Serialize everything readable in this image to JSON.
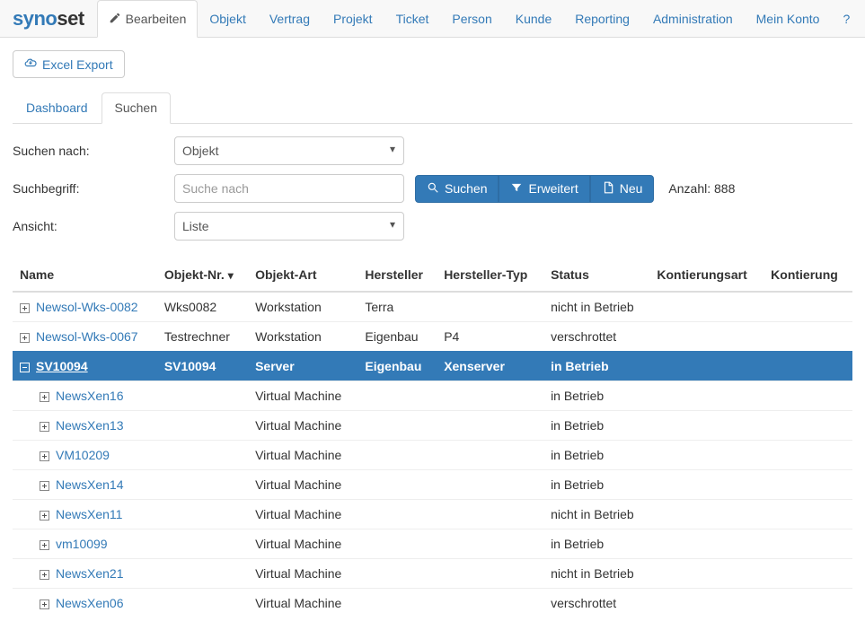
{
  "logo": {
    "part1": "syno",
    "part2": "set"
  },
  "nav": {
    "items": [
      {
        "label": "Bearbeiten",
        "icon": "edit",
        "active": true
      },
      {
        "label": "Objekt"
      },
      {
        "label": "Vertrag"
      },
      {
        "label": "Projekt"
      },
      {
        "label": "Ticket"
      },
      {
        "label": "Person"
      },
      {
        "label": "Kunde"
      },
      {
        "label": "Reporting"
      },
      {
        "label": "Administration"
      },
      {
        "label": "Mein Konto"
      },
      {
        "label": "?"
      }
    ]
  },
  "toolbar": {
    "excel_label": "Excel Export"
  },
  "subtabs": {
    "items": [
      {
        "label": "Dashboard",
        "active": false
      },
      {
        "label": "Suchen",
        "active": true
      }
    ]
  },
  "form": {
    "search_by_label": "Suchen nach:",
    "search_by_value": "Objekt",
    "term_label": "Suchbegriff:",
    "term_placeholder": "Suche nach",
    "term_value": "",
    "view_label": "Ansicht:",
    "view_value": "Liste",
    "buttons": {
      "search": "Suchen",
      "extended": "Erweitert",
      "new": "Neu"
    },
    "count_label": "Anzahl: 888"
  },
  "table": {
    "headers": {
      "name": "Name",
      "objnr": "Objekt-Nr.",
      "objart": "Objekt-Art",
      "hersteller": "Hersteller",
      "herstellertyp": "Hersteller-Typ",
      "status": "Status",
      "kontierungsart": "Kontierungsart",
      "kontierung": "Kontierung"
    },
    "sort": {
      "column": "objnr",
      "dir": "desc"
    },
    "rows": [
      {
        "level": 0,
        "expand": "plus",
        "selected": false,
        "name": "Newsol-Wks-0082",
        "objnr": "Wks0082",
        "art": "Workstation",
        "hersteller": "Terra",
        "htyp": "",
        "status": "nicht in Betrieb"
      },
      {
        "level": 0,
        "expand": "plus",
        "selected": false,
        "name": "Newsol-Wks-0067",
        "objnr": "Testrechner",
        "art": "Workstation",
        "hersteller": "Eigenbau",
        "htyp": "P4",
        "status": "verschrottet"
      },
      {
        "level": 0,
        "expand": "minus",
        "selected": true,
        "name": "SV10094",
        "objnr": "SV10094",
        "art": "Server",
        "hersteller": "Eigenbau",
        "htyp": "Xenserver",
        "status": "in Betrieb"
      },
      {
        "level": 1,
        "expand": "plus",
        "selected": false,
        "name": "NewsXen16",
        "objnr": "",
        "art": "Virtual Machine",
        "hersteller": "",
        "htyp": "",
        "status": "in Betrieb"
      },
      {
        "level": 1,
        "expand": "plus",
        "selected": false,
        "name": "NewsXen13",
        "objnr": "",
        "art": "Virtual Machine",
        "hersteller": "",
        "htyp": "",
        "status": "in Betrieb"
      },
      {
        "level": 1,
        "expand": "plus",
        "selected": false,
        "name": "VM10209",
        "objnr": "",
        "art": "Virtual Machine",
        "hersteller": "",
        "htyp": "",
        "status": "in Betrieb"
      },
      {
        "level": 1,
        "expand": "plus",
        "selected": false,
        "name": "NewsXen14",
        "objnr": "",
        "art": "Virtual Machine",
        "hersteller": "",
        "htyp": "",
        "status": "in Betrieb"
      },
      {
        "level": 1,
        "expand": "plus",
        "selected": false,
        "name": "NewsXen11",
        "objnr": "",
        "art": "Virtual Machine",
        "hersteller": "",
        "htyp": "",
        "status": "nicht in Betrieb"
      },
      {
        "level": 1,
        "expand": "plus",
        "selected": false,
        "name": "vm10099",
        "objnr": "",
        "art": "Virtual Machine",
        "hersteller": "",
        "htyp": "",
        "status": "in Betrieb"
      },
      {
        "level": 1,
        "expand": "plus",
        "selected": false,
        "name": "NewsXen21",
        "objnr": "",
        "art": "Virtual Machine",
        "hersteller": "",
        "htyp": "",
        "status": "nicht in Betrieb"
      },
      {
        "level": 1,
        "expand": "plus",
        "selected": false,
        "name": "NewsXen06",
        "objnr": "",
        "art": "Virtual Machine",
        "hersteller": "",
        "htyp": "",
        "status": "verschrottet"
      }
    ]
  }
}
